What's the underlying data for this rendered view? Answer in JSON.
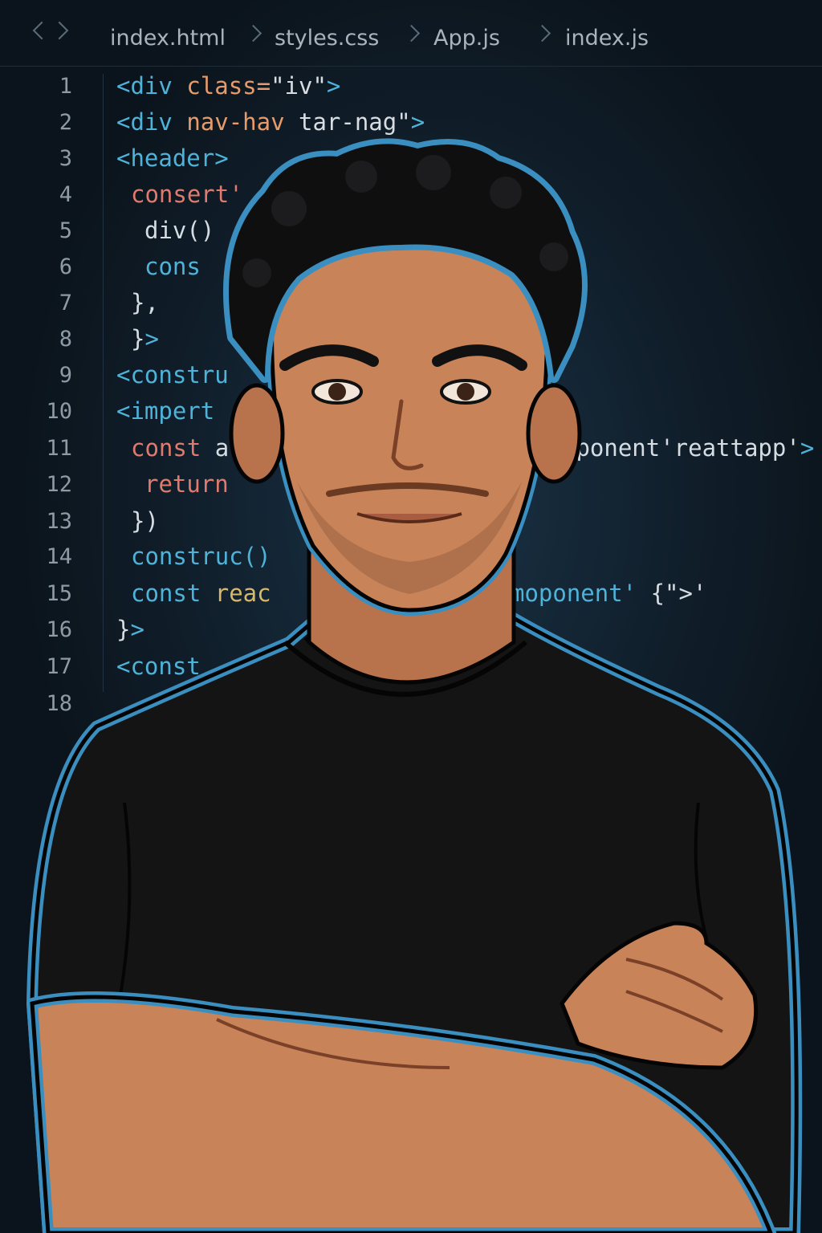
{
  "tabs": [
    "index.html",
    "styles.css",
    "App.js",
    "index.js"
  ],
  "line_numbers": [
    "1",
    "2",
    "3",
    "4",
    "5",
    "6",
    "7",
    "8",
    "9",
    "10",
    "11",
    "12",
    "13",
    "14",
    "15",
    "16",
    "17",
    "18"
  ],
  "code": {
    "l1_a": "<div ",
    "l1_b": "class=",
    "l1_c": "\"iv\"",
    "l1_d": ">",
    "l2_a": "<div ",
    "l2_b": "nav-hav ",
    "l2_c": "tar-nag\"",
    "l2_d": ">",
    "l3": "<header>",
    "l4": "consert'",
    "l5": "div()",
    "l6": "cons",
    "l7": "},",
    "l8_a": "}",
    "l8_b": ">",
    "l9": "<constru",
    "l10": "<impert",
    "l11_a": "const ",
    "l11_b": "a",
    "l11_r": "eponent'reattapp'",
    "l11_r2": ">",
    "l12": "return",
    "l13": "})",
    "l14": "construc()",
    "l15_a": "const ",
    "l15_b": "reac",
    "l15_r": "moponent'",
    "l15_r2": " {\">'",
    "l16_a": "}",
    "l16_b": ">",
    "l17": "<const"
  },
  "colors": {
    "background": "#0d1620",
    "outline": "#3a8fc0",
    "skin": "#c98359",
    "shirt": "#151515",
    "hair": "#0f0f10"
  },
  "icons": [
    "chevron-left-icon",
    "chevron-right-icon"
  ]
}
